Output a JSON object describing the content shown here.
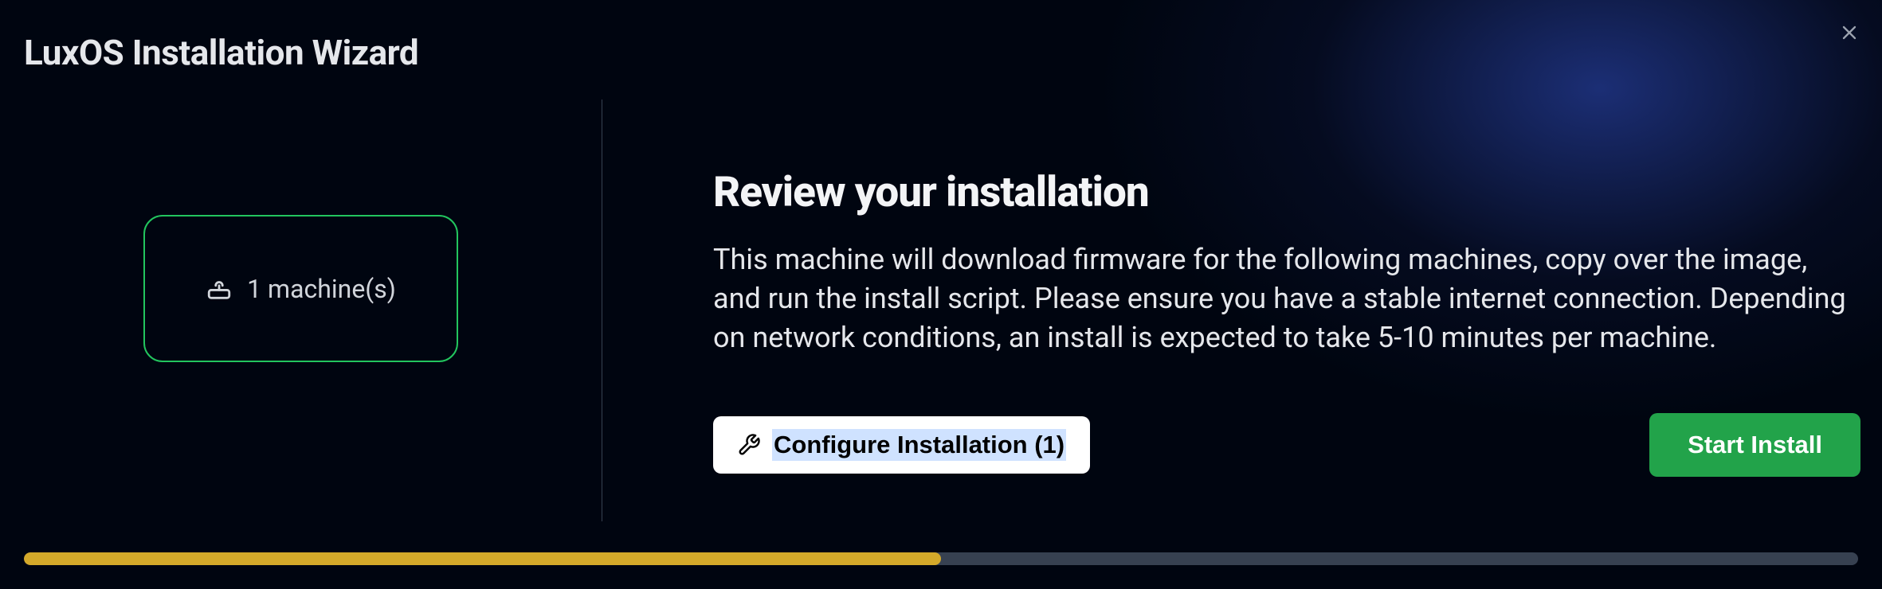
{
  "header": {
    "title": "LuxOS Installation Wizard"
  },
  "left": {
    "machine_label": "1 machine(s)"
  },
  "main": {
    "heading": "Review your installation",
    "description": "This machine will download firmware for the following machines, copy over the image, and run the install script. Please ensure you have a stable internet connection. Depending on network conditions, an install is expected to take 5-10 minutes per machine.",
    "configure_label": "Configure Installation (1)",
    "start_label": "Start Install"
  },
  "progress": {
    "percent": 50
  },
  "colors": {
    "accent_green": "#22c55e",
    "button_green": "#22a34a",
    "progress_fill": "#d4a92a",
    "progress_track": "#374151"
  }
}
